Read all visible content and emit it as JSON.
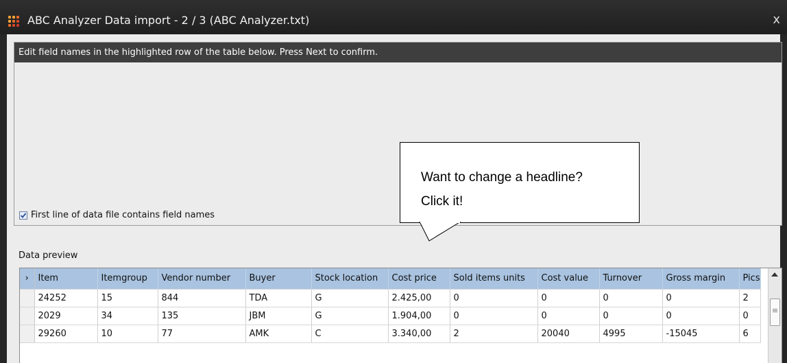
{
  "window": {
    "title": "ABC Analyzer Data import - 2 / 3 (ABC Analyzer.txt)",
    "close_glyph": "x",
    "icon": "app-grid-icon"
  },
  "instructions": {
    "text": "Edit field names in the highlighted row of the table below. Press Next to confirm."
  },
  "options": {
    "first_line_label": "First line of data file contains field names",
    "first_line_checked": true
  },
  "preview": {
    "label": "Data preview",
    "row_indicator": "›",
    "columns": [
      "Item",
      "Itemgroup",
      "Vendor number",
      "Buyer",
      "Stock location",
      "Cost price",
      "Sold items units",
      "Cost value",
      "Turnover",
      "Gross margin",
      "Pics"
    ],
    "rows": [
      [
        "24252",
        "15",
        "844",
        "TDA",
        "G",
        "2.425,00",
        "0",
        "0",
        "0",
        "0",
        "2"
      ],
      [
        "2029",
        "34",
        "135",
        "JBM",
        "G",
        "1.904,00",
        "0",
        "0",
        "0",
        "0",
        "0"
      ],
      [
        "29260",
        "10",
        "77",
        "AMK",
        "C",
        "3.340,00",
        "2",
        "20040",
        "4995",
        "-15045",
        "6"
      ]
    ]
  },
  "callout": {
    "line1": "Want to change a headline?",
    "line2": "Click it!"
  },
  "colors": {
    "titlebar": "#262626",
    "header_row": "#a9c3e0",
    "instruction_bar": "#3e3e3e"
  }
}
